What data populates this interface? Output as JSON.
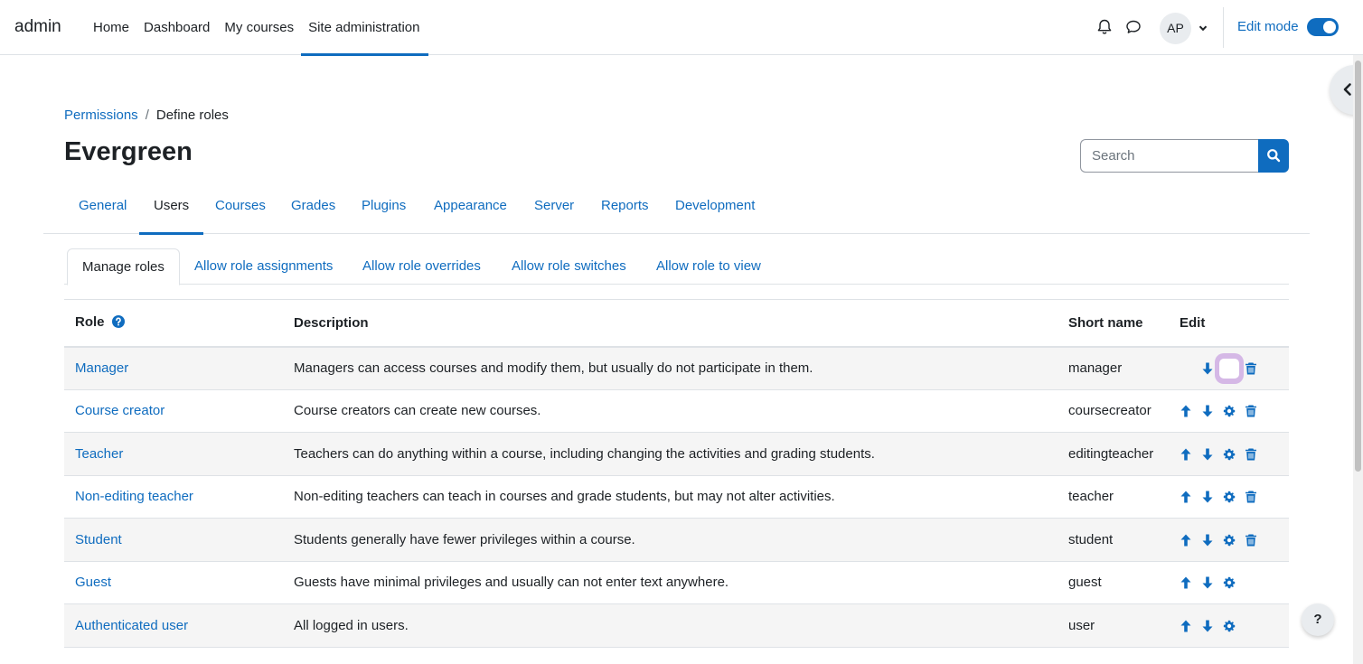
{
  "navbar": {
    "brand": "admin",
    "items": [
      {
        "label": "Home"
      },
      {
        "label": "Dashboard"
      },
      {
        "label": "My courses"
      },
      {
        "label": "Site administration"
      }
    ],
    "avatar_initials": "AP",
    "edit_mode_label": "Edit mode",
    "edit_mode_on": true
  },
  "breadcrumb": {
    "items": [
      "Permissions",
      "Define roles"
    ],
    "separator": "/"
  },
  "page": {
    "title": "Evergreen"
  },
  "search": {
    "placeholder": "Search"
  },
  "secondary_tabs": [
    "General",
    "Users",
    "Courses",
    "Grades",
    "Plugins",
    "Appearance",
    "Server",
    "Reports",
    "Development"
  ],
  "sub_tabs": [
    "Manage roles",
    "Allow role assignments",
    "Allow role overrides",
    "Allow role switches",
    "Allow role to view"
  ],
  "table": {
    "headers": {
      "role": "Role",
      "description": "Description",
      "short_name": "Short name",
      "edit": "Edit"
    },
    "rows": [
      {
        "role": "Manager",
        "description": "Managers can access courses and modify them, but usually do not participate in them.",
        "short_name": "manager"
      },
      {
        "role": "Course creator",
        "description": "Course creators can create new courses.",
        "short_name": "coursecreator"
      },
      {
        "role": "Teacher",
        "description": "Teachers can do anything within a course, including changing the activities and grading students.",
        "short_name": "editingteacher"
      },
      {
        "role": "Non-editing teacher",
        "description": "Non-editing teachers can teach in courses and grade students, but may not alter activities.",
        "short_name": "teacher"
      },
      {
        "role": "Student",
        "description": "Students generally have fewer privileges within a course.",
        "short_name": "student"
      },
      {
        "role": "Guest",
        "description": "Guests have minimal privileges and usually can not enter text anywhere.",
        "short_name": "guest"
      },
      {
        "role": "Authenticated user",
        "description": "All logged in users.",
        "short_name": "user"
      }
    ]
  },
  "help_button": "?",
  "colors": {
    "link": "#0f6cbf",
    "text": "#1d2125",
    "row_alt": "#f5f5f5",
    "highlight": "#c9a3e0"
  }
}
